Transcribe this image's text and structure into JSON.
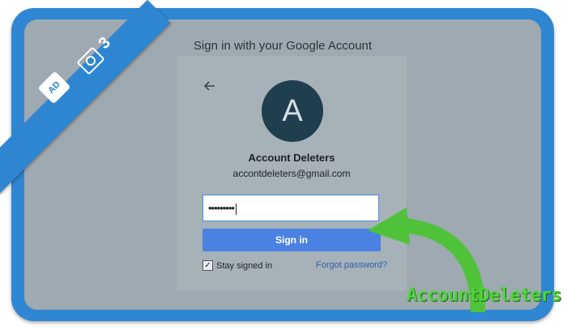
{
  "header": {
    "title": "Sign in with your Google Account"
  },
  "card": {
    "avatar_letter": "A",
    "account_name": "Account Deleters",
    "account_email": "accontdeleters@gmail.com",
    "password_mask": "•••••••••",
    "signin_label": "Sign in",
    "stay_signed_in_label": "Stay signed in",
    "stay_signed_in_checked": true,
    "forgot_label": "Forgot password?"
  },
  "badge": {
    "step_number": "3",
    "logo_text": "AD"
  },
  "watermark": {
    "text": "AccountDeleters"
  },
  "colors": {
    "frame": "#2f86d2",
    "screen": "#9ea9b1",
    "button": "#4a82e3",
    "arrow": "#4fc23a"
  },
  "icons": {
    "back": "arrow-left-icon",
    "camera": "camera-icon",
    "checkbox": "checkmark-icon"
  }
}
